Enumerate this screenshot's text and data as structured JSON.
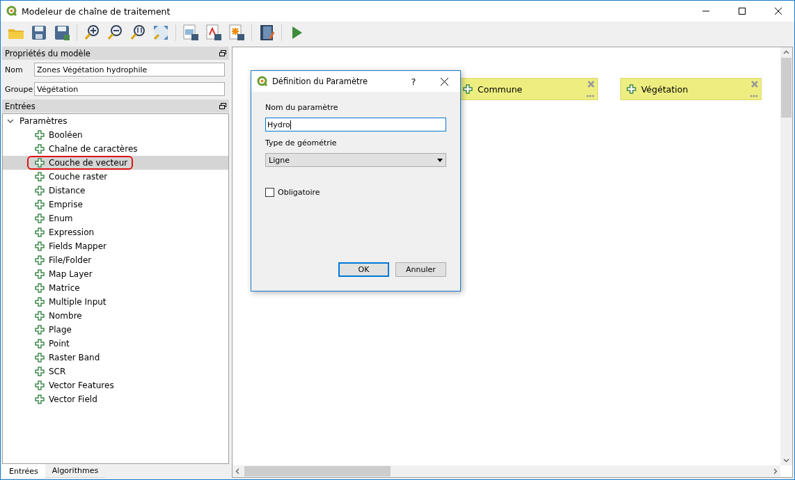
{
  "window": {
    "title": "Modeleur de chaîne de traitement"
  },
  "model_properties": {
    "title": "Propriétés du modèle",
    "fields": [
      {
        "label": "Nom",
        "value": "Zones Végétation hydrophile"
      },
      {
        "label": "Groupe",
        "value": "Végétation"
      }
    ]
  },
  "inputs": {
    "title": "Entrées",
    "tree": [
      {
        "label": "Paramètres",
        "expanded": true,
        "children": [
          {
            "label": "Booléen",
            "selected": false,
            "circled": false
          },
          {
            "label": "Chaîne de caractères",
            "selected": false,
            "circled": false
          },
          {
            "label": "Couche de vecteur",
            "selected": true,
            "circled": true
          },
          {
            "label": "Couche raster",
            "selected": false,
            "circled": false
          },
          {
            "label": "Distance",
            "selected": false,
            "circled": false
          },
          {
            "label": "Emprise",
            "selected": false,
            "circled": false
          },
          {
            "label": "Enum",
            "selected": false,
            "circled": false
          },
          {
            "label": "Expression",
            "selected": false,
            "circled": false
          },
          {
            "label": "Fields Mapper",
            "selected": false,
            "circled": false
          },
          {
            "label": "File/Folder",
            "selected": false,
            "circled": false
          },
          {
            "label": "Map Layer",
            "selected": false,
            "circled": false
          },
          {
            "label": "Matrice",
            "selected": false,
            "circled": false
          },
          {
            "label": "Multiple Input",
            "selected": false,
            "circled": false
          },
          {
            "label": "Nombre",
            "selected": false,
            "circled": false
          },
          {
            "label": "Plage",
            "selected": false,
            "circled": false
          },
          {
            "label": "Point",
            "selected": false,
            "circled": false
          },
          {
            "label": "Raster Band",
            "selected": false,
            "circled": false
          },
          {
            "label": "SCR",
            "selected": false,
            "circled": false
          },
          {
            "label": "Vector Features",
            "selected": false,
            "circled": false
          },
          {
            "label": "Vector Field",
            "selected": false,
            "circled": false
          }
        ]
      }
    ]
  },
  "bottom_tabs": [
    {
      "label": "Entrées",
      "selected": true
    },
    {
      "label": "Algorithmes",
      "selected": false
    }
  ],
  "canvas_nodes": [
    {
      "label": "Commune"
    },
    {
      "label": "Végétation"
    }
  ],
  "dialog": {
    "title": "Définition du Paramètre",
    "help": "?",
    "name_label": "Nom du paramètre",
    "name_value": "Hydro",
    "geometry_label": "Type de géométrie",
    "geometry_value": "Ligne",
    "mandatory": {
      "label": "Obligatoire",
      "checked": false
    },
    "buttons": [
      {
        "label": "OK",
        "default": true
      },
      {
        "label": "Annuler",
        "default": false
      }
    ]
  }
}
